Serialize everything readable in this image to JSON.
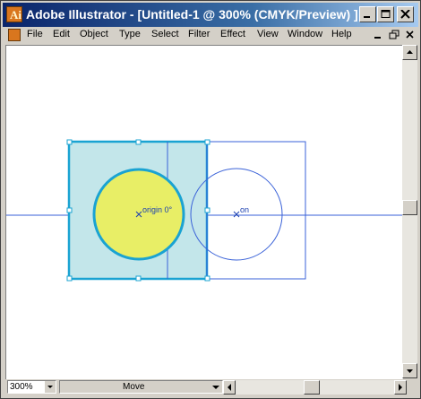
{
  "window": {
    "title": "Adobe Illustrator - [Untitled-1 @ 300% (CMYK/Preview) ]"
  },
  "menu": {
    "items": [
      "File",
      "Edit",
      "Object",
      "Type",
      "Select",
      "Filter",
      "Effect",
      "View",
      "Window",
      "Help"
    ]
  },
  "canvas": {
    "origin_label": "origin 0°",
    "copy_label": "on",
    "colors": {
      "fill_square": "#c3e6ea",
      "stroke_selected": "#1aa3d2",
      "fill_circle": "#e8ee66",
      "guide_blue": "#3a62d8"
    }
  },
  "status": {
    "zoom": "300%",
    "tool": "Move"
  }
}
